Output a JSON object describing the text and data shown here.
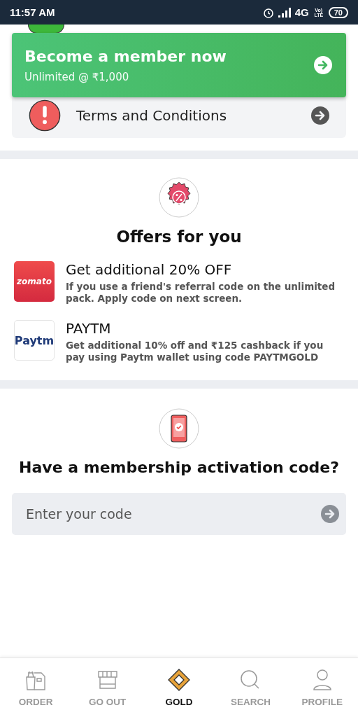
{
  "status_bar": {
    "time": "11:57 AM",
    "network": "4G",
    "carrier": "Vo) LTE",
    "battery": "70"
  },
  "membership_banner": {
    "title": "Become a member now",
    "subtitle": "Unlimited @ ₹1,000"
  },
  "terms_row": {
    "label": "Terms and Conditions"
  },
  "offers": {
    "title": "Offers for you",
    "items": [
      {
        "kind": "zomato",
        "logo": "zomato",
        "title": "Get additional 20% OFF",
        "description": "If you use a friend's referral code on the unlimited pack. Apply code on next screen."
      },
      {
        "kind": "paytm",
        "logo": "Paytm",
        "title": "PAYTM",
        "description": "Get additional 10% off and ₹125 cashback if you pay using Paytm wallet using code PAYTMGOLD"
      }
    ]
  },
  "activation": {
    "title": "Have a membership activation code?",
    "placeholder": "Enter your code"
  },
  "bottom_nav": [
    {
      "kind": "order",
      "label": "ORDER",
      "selected": false
    },
    {
      "kind": "goout",
      "label": "GO OUT",
      "selected": false
    },
    {
      "kind": "gold",
      "label": "GOLD",
      "selected": true
    },
    {
      "kind": "search",
      "label": "SEARCH",
      "selected": false
    },
    {
      "kind": "profile",
      "label": "PROFILE",
      "selected": false
    }
  ]
}
